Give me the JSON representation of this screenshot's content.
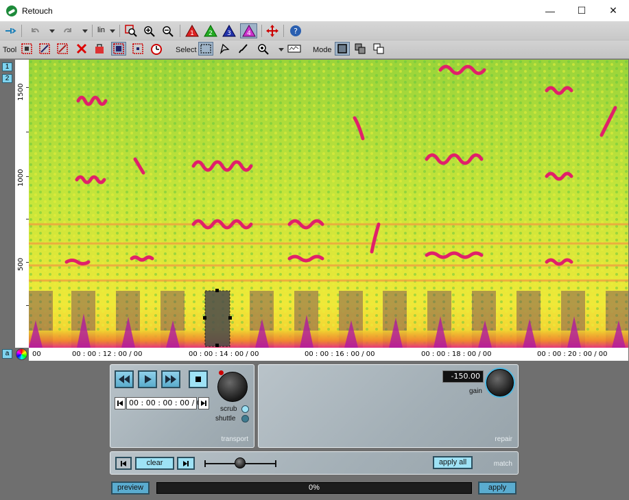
{
  "window": {
    "title": "Retouch",
    "minimize": "—",
    "maximize": "☐",
    "close": "✕"
  },
  "toolbar": {
    "scale_select": "lin",
    "tool_label": "Tool",
    "select_label": "Select",
    "mode_label": "Mode",
    "layers": [
      "1",
      "2",
      "3",
      "4"
    ]
  },
  "left_strip": {
    "channel1": "1",
    "channel2": "2",
    "a_button": "a"
  },
  "frequency_axis": {
    "labels": [
      "1500",
      "1000",
      "500"
    ]
  },
  "time_axis": {
    "labels": [
      "00",
      "00 : 00 : 12 : 00 / 00",
      "00 : 00 : 14 : 00 / 00",
      "00 : 00 : 16 : 00 / 00",
      "00 : 00 : 18 : 00 / 00",
      "00 : 00 : 20 : 00 / 00"
    ]
  },
  "transport": {
    "caption": "transport",
    "timecode": "00 : 00 : 00 : 00 / 00",
    "scrub_label": "scrub",
    "shuttle_label": "shuttle"
  },
  "repair": {
    "caption": "repair",
    "gain_value": "-150.00",
    "gain_label": "gain"
  },
  "match": {
    "caption": "match",
    "clear_label": "clear",
    "apply_all_label": "apply all",
    "slider_position": 0.5
  },
  "bottom": {
    "preview_label": "preview",
    "progress_text": "0%",
    "progress_value": 0,
    "apply_label": "apply"
  },
  "colors": {
    "accent_teal": "#9ee2f5",
    "active_layer": "#6a48c8",
    "selection_box": "#4a4a4a"
  }
}
